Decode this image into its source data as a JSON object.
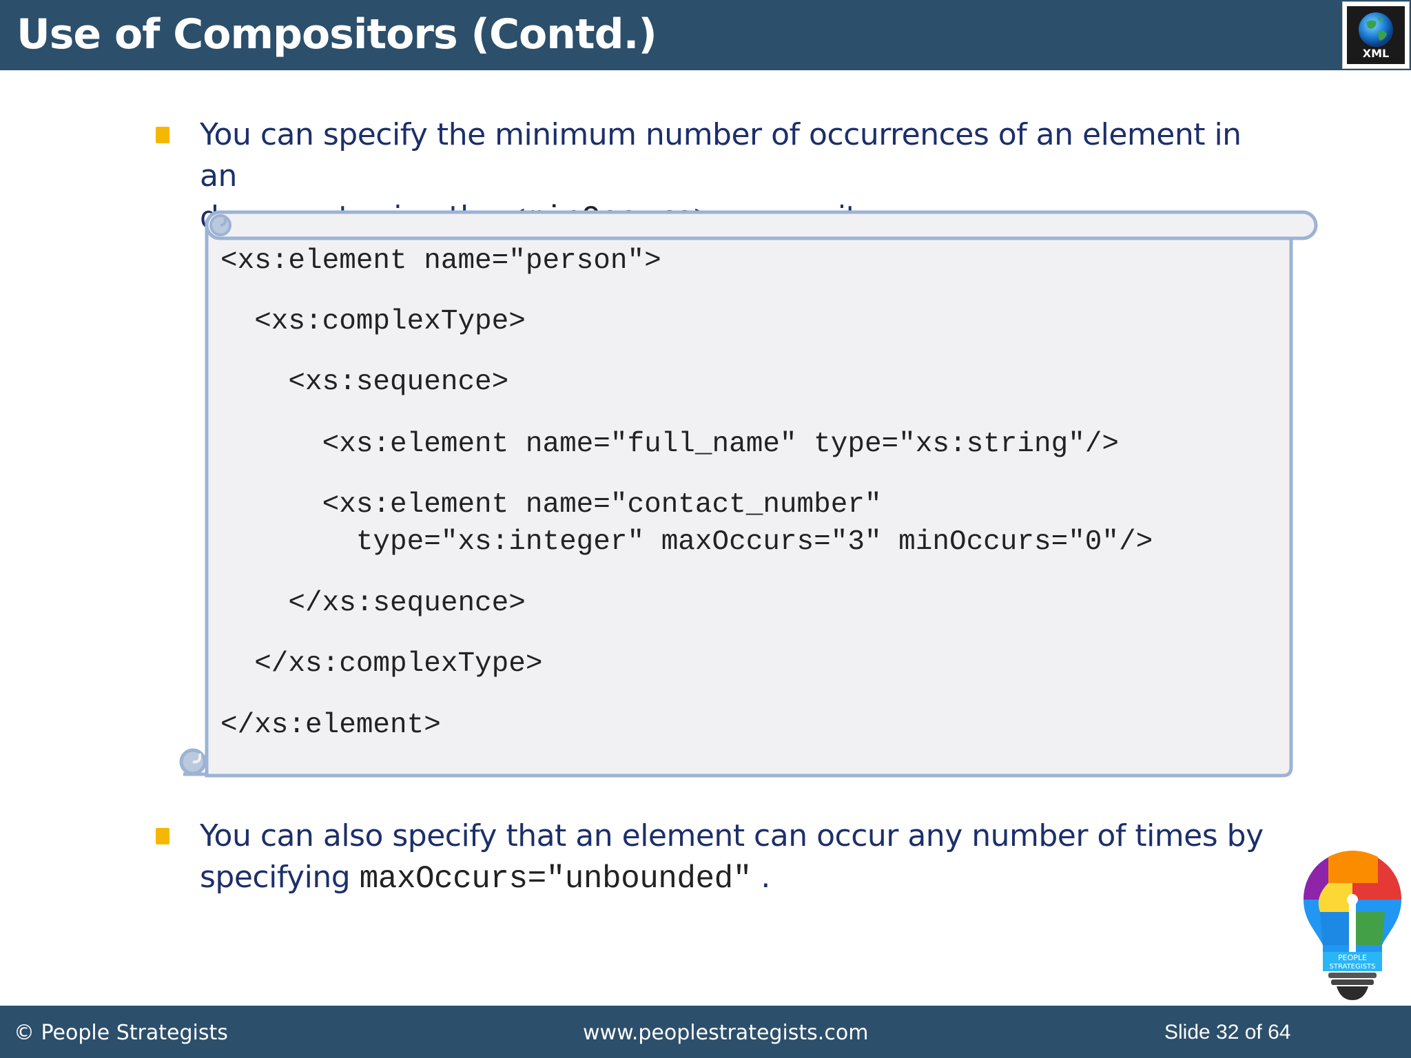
{
  "slide": {
    "title": "Use of Compositors (Contd.)",
    "logo_label": "XML"
  },
  "bullets": [
    {
      "line1": "You can specify the minimum number of occurrences of an element in an",
      "line2_pre": "document using the ",
      "line2_code": "<minOccurs>",
      "line2_post": " compositor."
    },
    {
      "line1": "You can also specify that an element can occur any number of times by",
      "line2_pre": "specifying ",
      "line2_code": "maxOccurs=\"unbounded\"",
      "line2_post": " ."
    }
  ],
  "code_lines": [
    "<xs:element name=\"person\">",
    "  <xs:complexType>",
    "    <xs:sequence>",
    "      <xs:element name=\"full_name\" type=\"xs:string\"/>",
    "      <xs:element name=\"contact_number\"",
    "        type=\"xs:integer\" maxOccurs=\"3\" minOccurs=\"0\"/>",
    "    </xs:sequence>",
    "  </xs:complexType>",
    "</xs:element>"
  ],
  "footer": {
    "copyright": "© People Strategists",
    "website": "www.peoplestrategists.com",
    "slide_number": "Slide 32 of 64"
  },
  "bulb_logo_text": [
    "PEOPLE",
    "STRATEGISTS"
  ],
  "colors": {
    "header": "#2c4f6b",
    "bullet": "#f5b800",
    "text": "#1c2f6b",
    "scroll_fill": "#f1f1f3",
    "scroll_border": "#9db3d4"
  }
}
